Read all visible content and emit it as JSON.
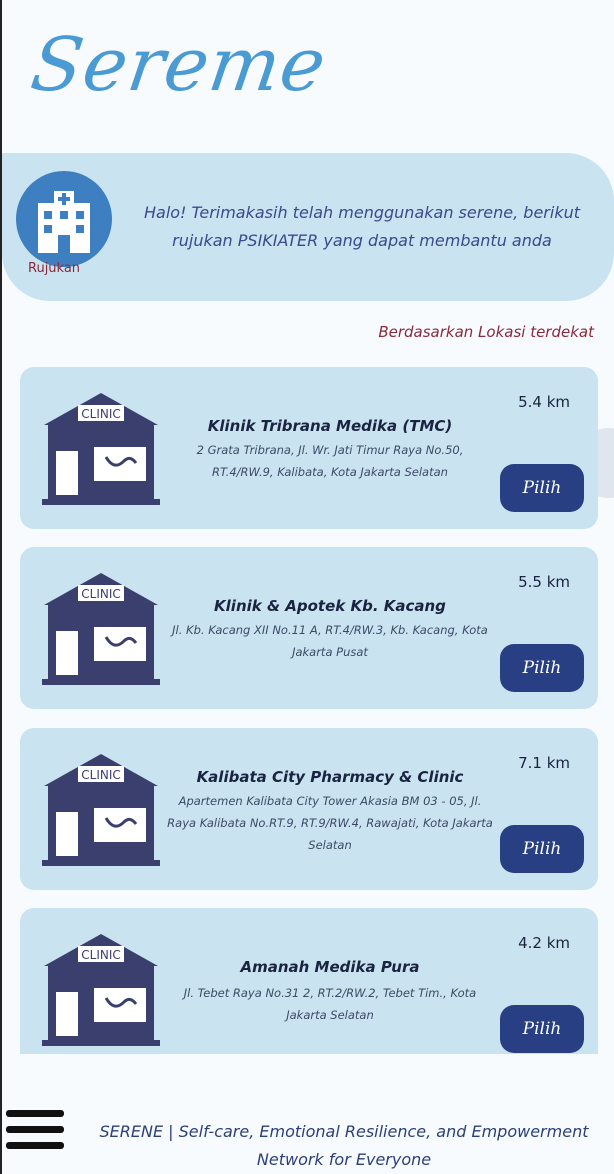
{
  "app": {
    "logo": "Sereme"
  },
  "banner": {
    "badge_label": "Rujukan",
    "message": "Halo! Terimakasih telah menggunakan serene, berikut rujukan PSIKIATER yang dapat membantu anda"
  },
  "location_note": "Berdasarkan Lokasi terdekat",
  "pick_label": "Pilih",
  "clinics": [
    {
      "name": "Klinik Tribrana Medika (TMC)",
      "address": "2 Grata Tribrana, Jl. Wr. Jati Timur Raya No.50, RT.4/RW.9, Kalibata, Kota Jakarta Selatan",
      "distance": "5.4 km"
    },
    {
      "name": "Klinik & Apotek Kb. Kacang",
      "address": "Jl. Kb. Kacang XII No.11 A, RT.4/RW.3, Kb. Kacang, Kota Jakarta Pusat",
      "distance": "5.5 km"
    },
    {
      "name": "Kalibata City Pharmacy & Clinic",
      "address": "Apartemen Kalibata City Tower Akasia BM 03 - 05, Jl. Raya Kalibata No.RT.9, RT.9/RW.4, Rawajati, Kota Jakarta Selatan",
      "distance": "7.1 km"
    },
    {
      "name": "Amanah Medika Pura",
      "address": "Jl. Tebet Raya No.31 2, RT.2/RW.2, Tebet Tim., Kota Jakarta Selatan",
      "distance": "4.2 km"
    }
  ],
  "footer": {
    "tagline": "SERENE | Self-care, Emotional Resilience, and Empowerment Network for Everyone"
  },
  "colors": {
    "accent": "#283f83",
    "card": "#c9e3f1",
    "logo": "#4a9ad3"
  }
}
